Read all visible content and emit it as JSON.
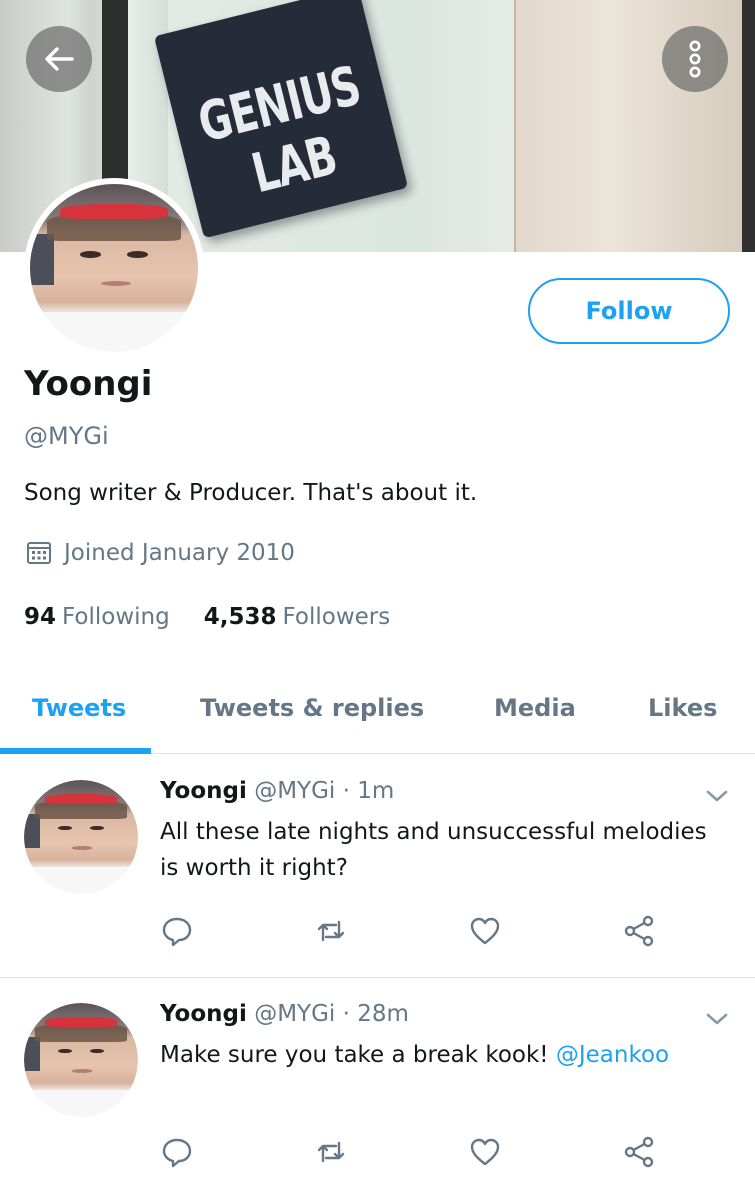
{
  "banner": {
    "sign_text": "GENIUS LAB"
  },
  "icons": {
    "back": "arrow-left-icon",
    "more": "more-vertical-icon",
    "calendar": "calendar-icon",
    "caret": "chevron-down-icon",
    "reply": "reply-icon",
    "retweet": "retweet-icon",
    "like": "heart-icon",
    "share": "share-icon"
  },
  "colors": {
    "accent": "#1da1f2",
    "secondary_text": "#657786",
    "primary_text": "#14171a",
    "divider": "#e1e8ed"
  },
  "profile": {
    "follow_label": "Follow",
    "name": "Yoongi",
    "handle": "@MYGi",
    "bio": "Song writer & Producer. That's about it.",
    "joined": "Joined January 2010",
    "following_count": "94",
    "following_label": "Following",
    "followers_count": "4,538",
    "followers_label": "Followers"
  },
  "tabs": [
    {
      "label": "Tweets",
      "active": true
    },
    {
      "label": "Tweets & replies",
      "active": false
    },
    {
      "label": "Media",
      "active": false
    },
    {
      "label": "Likes",
      "active": false
    }
  ],
  "tweets": [
    {
      "name": "Yoongi",
      "meta": "@MYGi · 1m",
      "text": "All these late nights and unsuccessful melodies is worth it right?",
      "mention": ""
    },
    {
      "name": "Yoongi",
      "meta": "@MYGi · 28m",
      "text": "Make sure you take a break kook!",
      "mention": "@Jeankoo"
    }
  ]
}
